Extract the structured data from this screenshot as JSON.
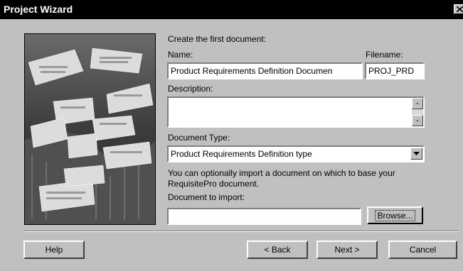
{
  "window": {
    "title": "Project Wizard"
  },
  "form": {
    "intro": "Create the first document:",
    "name_label": "Name:",
    "name_value": "Product Requirements Definition Documen",
    "filename_label": "Filename:",
    "filename_value": "PROJ_PRD",
    "description_label": "Description:",
    "description_value": "",
    "doctype_label": "Document Type:",
    "doctype_value": "Product Requirements Definition type",
    "import_note_line1": "You can optionally import a document on which to base your",
    "import_note_line2": "RequisitePro document.",
    "import_label": "Document to import:",
    "import_value": "",
    "browse_label": "Browse..."
  },
  "footer": {
    "help_label": "Help",
    "back_label": "< Back",
    "next_label": "Next >",
    "cancel_label": "Cancel"
  },
  "icons": {
    "close": "close-icon",
    "scroll_up": "arrow-up-icon",
    "scroll_down": "arrow-down-icon",
    "dropdown": "chevron-down-icon"
  }
}
